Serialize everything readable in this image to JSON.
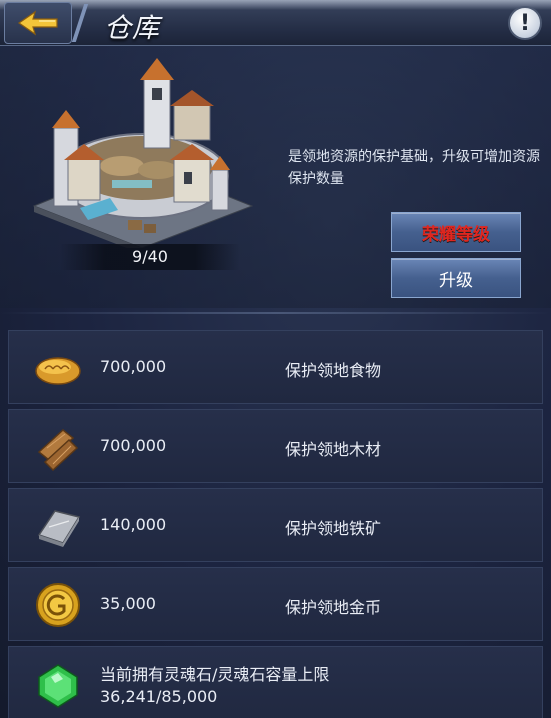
{
  "header": {
    "title": "仓库",
    "back_icon": "back-arrow-icon",
    "info_icon": "exclamation-icon",
    "info_label": "!"
  },
  "building": {
    "name_icon": "warehouse-building-icon",
    "level": "9/40",
    "description": "是领地资源的保护基础，升级可增加资源保护数量"
  },
  "buttons": {
    "honor_level": "荣耀等级",
    "upgrade": "升级"
  },
  "resources": [
    {
      "icon": "bread-icon",
      "amount": "700,000",
      "label": "保护领地食物"
    },
    {
      "icon": "wood-planks-icon",
      "amount": "700,000",
      "label": "保护领地木材"
    },
    {
      "icon": "iron-ingot-icon",
      "amount": "140,000",
      "label": "保护领地铁矿"
    },
    {
      "icon": "gold-coin-icon",
      "amount": "35,000",
      "label": "保护领地金币"
    }
  ],
  "soulstone": {
    "icon": "green-gem-icon",
    "label": "当前拥有灵魂石/灵魂石容量上限",
    "value": "36,241/85,000"
  },
  "colors": {
    "honor_text": "#e0261f",
    "button_fill": "#45608f",
    "background": "#1c2440"
  }
}
